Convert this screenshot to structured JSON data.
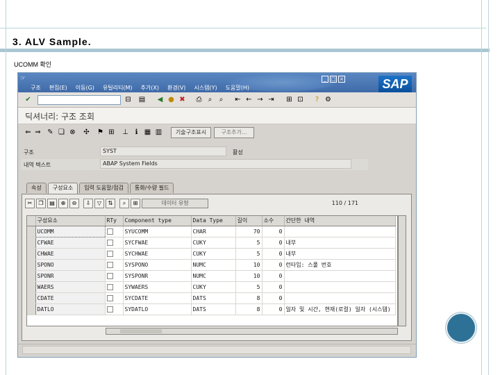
{
  "slide": {
    "title": "3. ALV Sample.",
    "subtitle": "UCOMM 확인"
  },
  "sap": {
    "menu": [
      "구조",
      "편집(E)",
      "이동(G)",
      "유틸리티(M)",
      "추가(X)",
      "환경(V)",
      "시스템(Y)",
      "도움말(H)"
    ],
    "logo": "SAP",
    "title": "딕셔너리: 구조 조회",
    "app_buttons": [
      "기술구조표시",
      "구조추가..."
    ],
    "fields": [
      {
        "label": "구조",
        "value": "SYST",
        "suffix": "활성"
      },
      {
        "label": "내역 텍스트",
        "value": "ABAP System Fields",
        "suffix": ""
      }
    ],
    "tabs": [
      "속성",
      "구성요소",
      "입력 도움말/점검",
      "통화/수량 필드"
    ],
    "active_tab": 1,
    "new_rows_button": "데이터 유형",
    "counter": "110  /  171",
    "columns": [
      "구성요소",
      "RTy",
      "Component type",
      "Data Type",
      "길이",
      "소수",
      "간단한 내역"
    ],
    "rows": [
      [
        "UCOMM",
        "SYUCOMM",
        "CHAR",
        "70",
        "0",
        ""
      ],
      [
        "CFWAE",
        "SYCFWAE",
        "CUKY",
        "5",
        "0",
        "내부"
      ],
      [
        "CHWAE",
        "SYCHWAE",
        "CUKY",
        "5",
        "0",
        "내부"
      ],
      [
        "SPONO",
        "SYSPONO",
        "NUMC",
        "10",
        "0",
        "런타임: 스풀 번호"
      ],
      [
        "SPONR",
        "SYSPONR",
        "NUMC",
        "10",
        "0",
        ""
      ],
      [
        "WAERS",
        "SYWAERS",
        "CUKY",
        "5",
        "0",
        ""
      ],
      [
        "CDATE",
        "SYCDATE",
        "DATS",
        "8",
        "0",
        ""
      ],
      [
        "DATLO",
        "SYDATLO",
        "DATS",
        "8",
        "0",
        "일자 및 시간, 현재(로컬) 일자 (시스템)"
      ]
    ]
  }
}
